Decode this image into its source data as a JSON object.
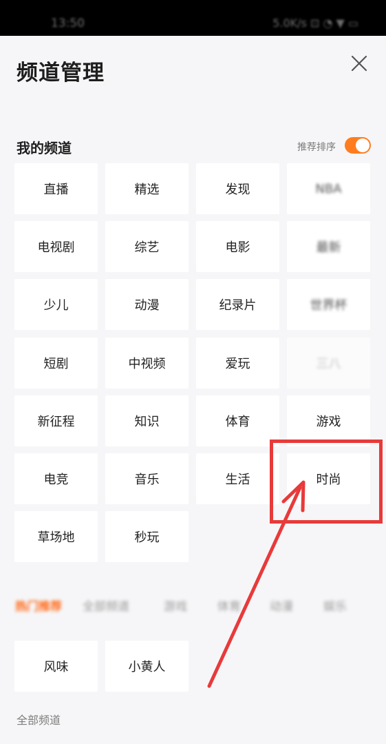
{
  "status_bar": {
    "time": "13:50",
    "icons": "5.0K/s ⊡ ◔ ▼ ▭"
  },
  "header": {
    "title": "频道管理",
    "close_icon": "close-icon"
  },
  "my_channels": {
    "title": "我的频道",
    "sort_label": "推荐排序",
    "sort_enabled": true,
    "items": [
      "直播",
      "精选",
      "发现",
      "NBA",
      "电视剧",
      "综艺",
      "电影",
      "最新",
      "少儿",
      "动漫",
      "纪录片",
      "世界杯",
      "短剧",
      "中视频",
      "爱玩",
      "三八",
      "新征程",
      "知识",
      "体育",
      "游戏",
      "电竞",
      "音乐",
      "生活",
      "时尚",
      "草场地",
      "秒玩"
    ]
  },
  "category_tabs": [
    "热门推荐",
    "全部频道",
    "游戏",
    "体育",
    "动漫",
    "娱乐"
  ],
  "recommended_channels": [
    "风味",
    "小黄人"
  ],
  "all_channels_label": "全部频道",
  "colors": {
    "accent": "#ff7d1f",
    "highlight": "#e83a3a",
    "background": "#f6f6f8"
  }
}
